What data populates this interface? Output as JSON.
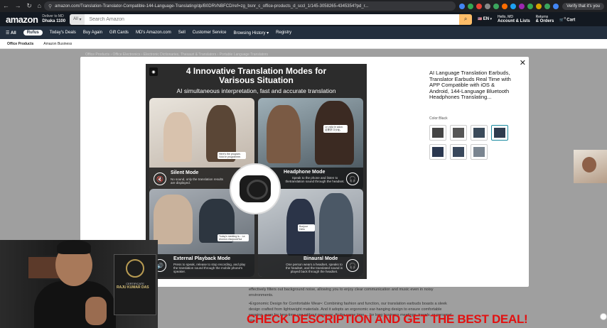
{
  "browser": {
    "url": "amazon.com/Translation-Translator-Compatible-144-Language-Translating/dp/B0DRVNBFCD/ref=zg_bsnr_c_office-products_d_sccl_1/145-3058265-4345354?pd_r...",
    "verify_label": "Verify that it's you",
    "ext_colors": [
      "#4285f4",
      "#34a853",
      "#ea4335",
      "#888",
      "#3ba55d",
      "#ff6d00",
      "#1da1f2",
      "#9c27b0",
      "#34a853",
      "#d6a300",
      "#3ba55d",
      "#4285f4"
    ]
  },
  "header": {
    "logo": "amazon",
    "deliver_line1": "Deliver to MD",
    "deliver_line2": "Dhaka 1100",
    "search_category": "All",
    "search_placeholder": "Search Amazon",
    "lang": "EN",
    "account_line1": "Hello, MD",
    "account_line2": "Account & Lists",
    "returns_line1": "Returns",
    "returns_line2": "& Orders",
    "cart_count": "0",
    "cart_label": "Cart"
  },
  "subnav": {
    "all": "All",
    "rufus": "Rufus",
    "items": [
      "Today's Deals",
      "Buy Again",
      "Gift Cards",
      "MD's Amazon.com",
      "Sell",
      "Customer Service",
      "Browsing History",
      "Registry"
    ]
  },
  "catbar": {
    "items": [
      "Office Products",
      "Amazon Business"
    ]
  },
  "breadcrumb": "Office Products › Office Electronics › Electronic Dictionaries, Thesauri & Translators › Portable Language Translators",
  "description": {
    "line1": "effectively filters out background noise, allowing you to enjoy clear communication and music even in noisy environments.",
    "line2": "•Ergonomic Design for Comfortable Wear•: Combining fashion and function, our translation earbuds boasts a sleek design crafted from lightweight materials. And it adopts an ergonomic ear-hanging design to ensure comfortable wearing, even for long time use without pressure. At the same time, ...for long business meetings, travels, or personal use."
  },
  "modal": {
    "image": {
      "headline": "4 Innovative Translation Modes for Varisous Situation",
      "subline": "AI simultaneous interpretation, fast and accurate translation",
      "modes": [
        {
          "title": "Silent Mode",
          "desc": "No sound, only the translation results are displayed."
        },
        {
          "title": "Headphone Mode",
          "desc": "Speak to the phone and listen to thetranslation sound through the headset."
        },
        {
          "title": "External Playback Mode",
          "desc": "Press to speak, release to stop recording, and play the translation sound through the mobile phone's speaker."
        },
        {
          "title": "Binaural Mode",
          "desc": "One person wears a headset, speaks to the headset, and the translated sound is played back through the headset."
        }
      ],
      "bubbles": [
        "Here's the program. Voici le programme.",
        "Le voilà le salon. 这是学习沙龙。",
        "Today's meeting is... La réunion d'aujourd'hui",
        "Bonjour Hello"
      ]
    },
    "title": "AI Language Translation Earbuds, Translator Earbuds Real Time with APP Compatible with iOS & Android, 144-Language Bluetooth Headphones Translating...",
    "color_label": "Color:Black",
    "thumb_colors": [
      "#444",
      "#555",
      "#3a4a5a",
      "#2e3b4e",
      "#2b3850",
      "#39485c",
      "#7a8590"
    ],
    "selected_thumb": 4
  },
  "webcam": {
    "cert_text": "CERTIFICATE",
    "name_text": "RAJU KUMAR DAS"
  },
  "banner": "CHECK DESCRIPTION AND GET THE BEST DEAL!"
}
